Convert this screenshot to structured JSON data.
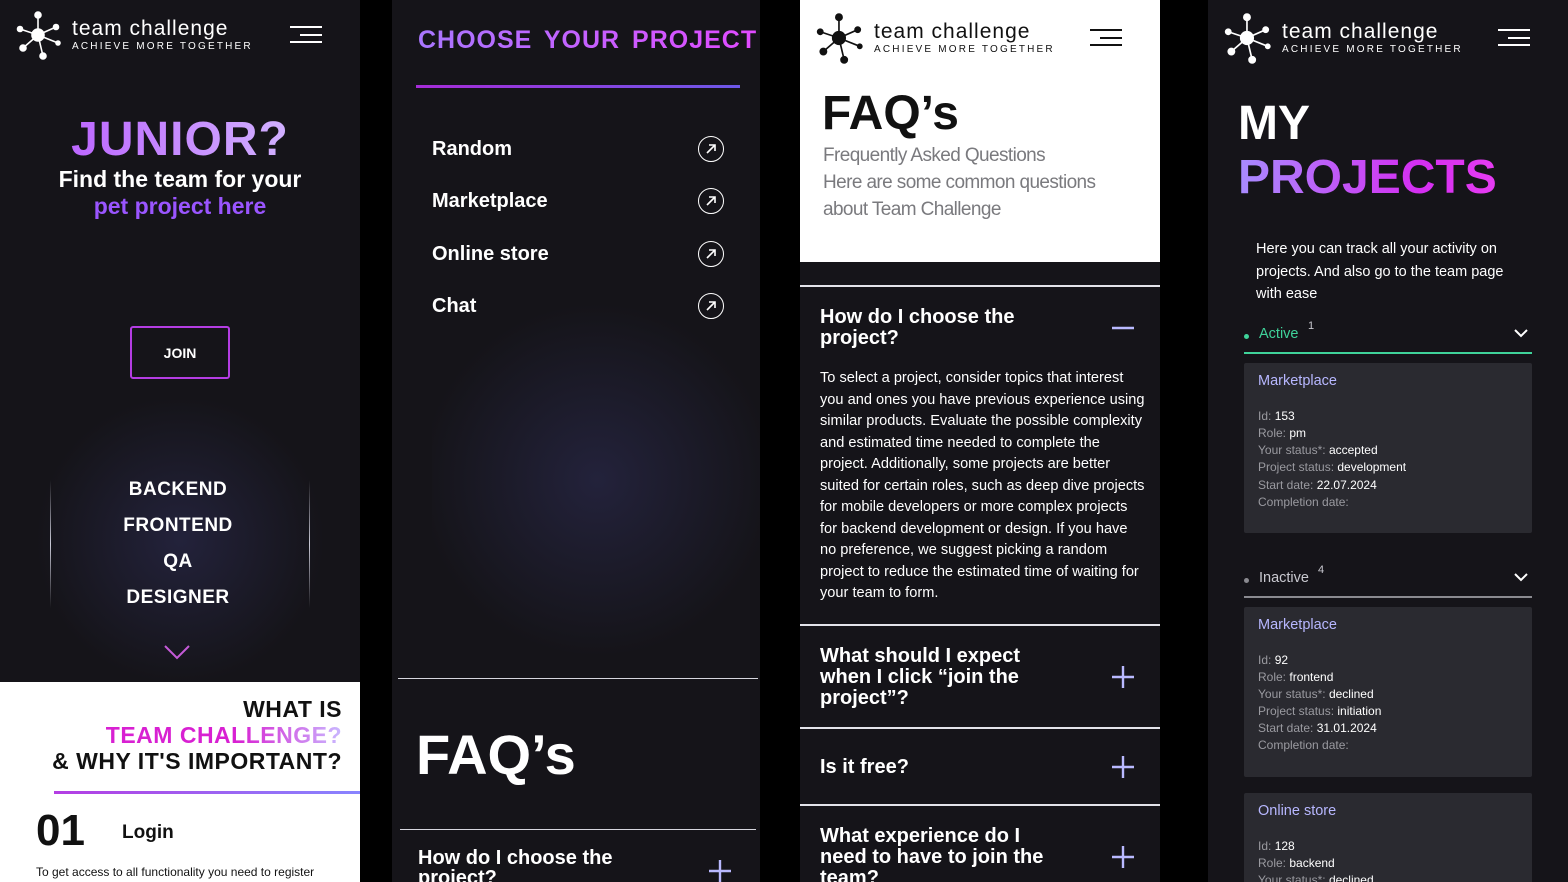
{
  "brand": {
    "name": "team challenge",
    "tagline": "ACHIEVE MORE TOGETHER"
  },
  "colors": {
    "accent_purple": "#9a55ff",
    "accent_magenta": "#d820d2",
    "active_green": "#3fd39a",
    "panel_bg": "#151419",
    "card_bg": "#2a2a30"
  },
  "home": {
    "headline": "JUNIOR?",
    "subline": "Find the team for your",
    "highlight": "pet project here",
    "join_label": "JOIN",
    "roles": [
      "BACKEND",
      "FRONTEND",
      "QA",
      "DESIGNER"
    ],
    "what_is": "WHAT IS",
    "team_challenge": "TEAM CHALLENGE?",
    "why": "& WHY IT'S IMPORTANT?",
    "step": {
      "number": "01",
      "title": "Login",
      "text": "To get access to all functionality you need to register"
    }
  },
  "choose": {
    "title": "CHOOSE YOUR PROJECT",
    "projects": [
      "Random",
      "Marketplace",
      "Online store",
      "Chat"
    ],
    "faq_title": "FAQ’s",
    "first_question": "How do I choose the project?"
  },
  "faq": {
    "title": "FAQ’s",
    "subtitle": "Frequently Asked Questions",
    "description": "Here are some common questions about Team Challenge",
    "items": [
      {
        "question": "How do I choose the project?",
        "expanded": true,
        "answer": "To select a project, consider topics that interest you and ones you have previous experience using similar products. Evaluate the possible complexity and estimated time needed to complete the project. Additionally, some projects are better suited for certain roles, such as deep dive projects for mobile developers or more complex projects for backend development or design. If you have no preference, we suggest picking a random project to reduce the estimated time of waiting for your team to form."
      },
      {
        "question": "What should I expect when I click “join the project”?",
        "expanded": false
      },
      {
        "question": "Is it free?",
        "expanded": false
      },
      {
        "question": "What experience do I need to have to join the team?",
        "expanded": false
      }
    ]
  },
  "my_projects": {
    "title_line1": "MY",
    "title_line2": "PROJECTS",
    "intro": "Here you can track all your activity on projects. And also go to the team page with ease",
    "labels": {
      "id": "Id:",
      "role": "Role:",
      "your_status": "Your status*:",
      "project_status": "Project status:",
      "start_date": "Start date:",
      "completion_date": "Completion date:"
    },
    "active": {
      "label": "Active",
      "count": "1",
      "projects": [
        {
          "name": "Marketplace",
          "id": "153",
          "role": "pm",
          "your_status": "accepted",
          "project_status": "development",
          "start_date": "22.07.2024",
          "completion_date": ""
        }
      ]
    },
    "inactive": {
      "label": "Inactive",
      "count": "4",
      "projects": [
        {
          "name": "Marketplace",
          "id": "92",
          "role": "frontend",
          "your_status": "declined",
          "project_status": "initiation",
          "start_date": "31.01.2024",
          "completion_date": ""
        },
        {
          "name": "Online store",
          "id": "128",
          "role": "backend",
          "your_status": "declined"
        }
      ]
    }
  }
}
